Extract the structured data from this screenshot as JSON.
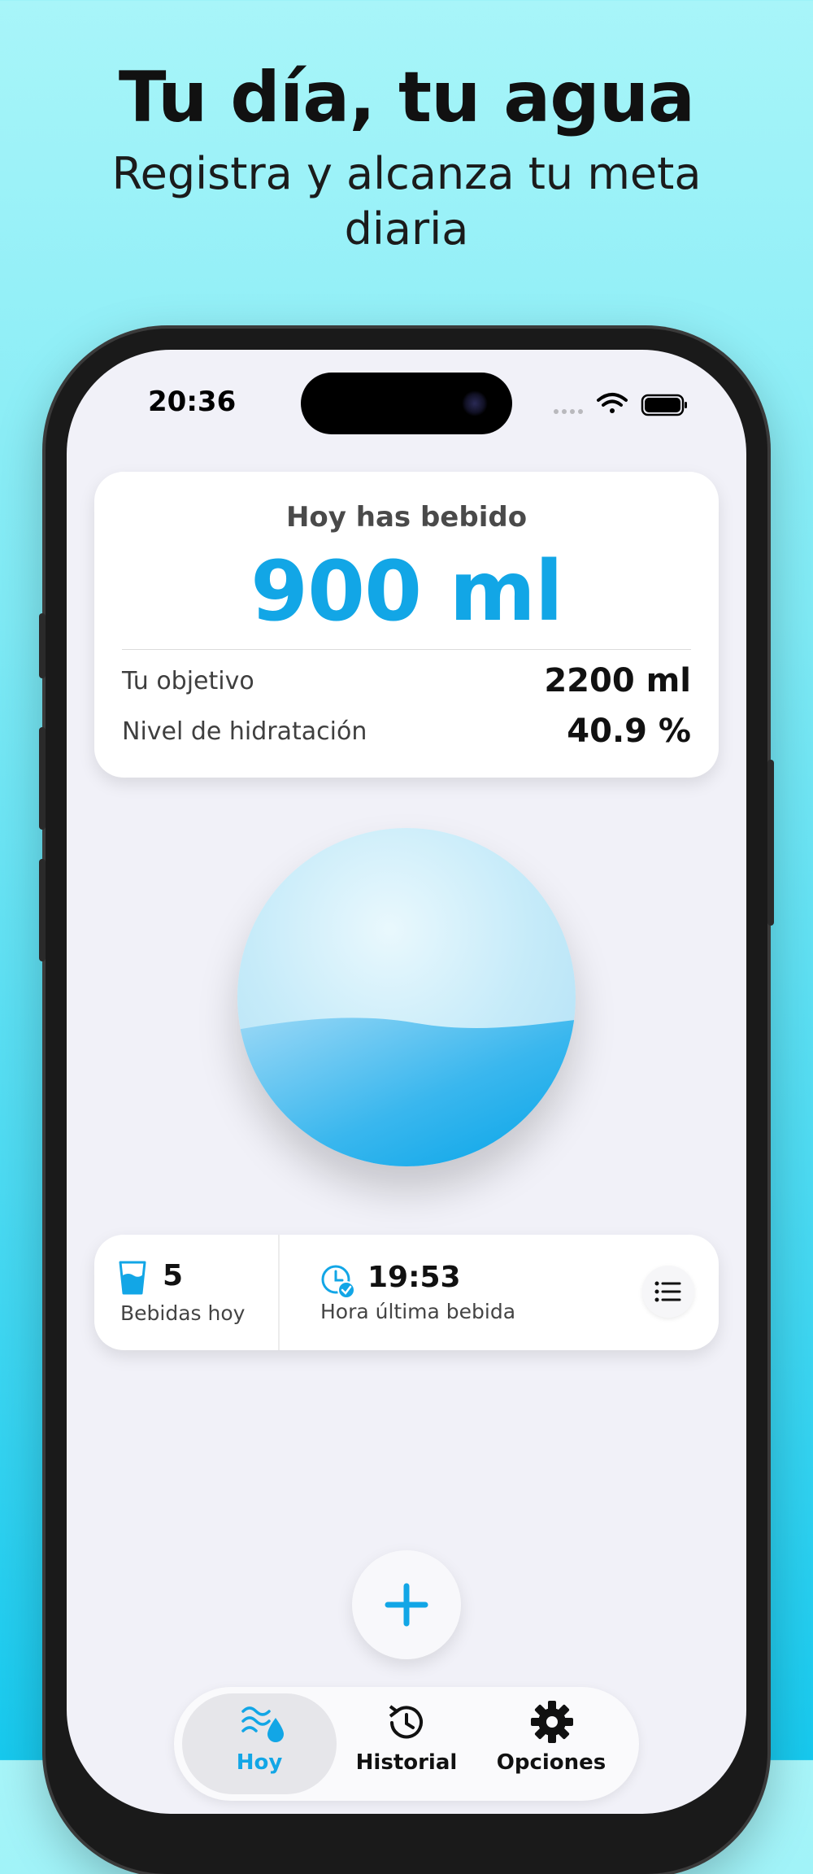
{
  "promo": {
    "headline": "Tu día, tu agua",
    "subline": "Registra y alcanza tu meta diaria"
  },
  "status_bar": {
    "time": "20:36",
    "icons": [
      "signal-icon",
      "wifi-icon",
      "battery-icon"
    ]
  },
  "summary": {
    "title": "Hoy has bebido",
    "amount": "900 ml",
    "goal_label": "Tu objetivo",
    "goal_value": "2200 ml",
    "hydration_label": "Nivel de hidratación",
    "hydration_value": "40.9 %",
    "fill_fraction": 0.409
  },
  "stats": {
    "drinks_count": "5",
    "drinks_label": "Bebidas hoy",
    "last_time": "19:53",
    "last_label": "Hora última bebida"
  },
  "tabs": [
    {
      "label": "Hoy",
      "icon": "water-waves-icon",
      "active": true
    },
    {
      "label": "Historial",
      "icon": "history-icon",
      "active": false
    },
    {
      "label": "Opciones",
      "icon": "gear-icon",
      "active": false
    }
  ],
  "colors": {
    "accent": "#12a6e6",
    "background_top": "#a8f5f9",
    "background_bottom": "#17c9ee"
  }
}
